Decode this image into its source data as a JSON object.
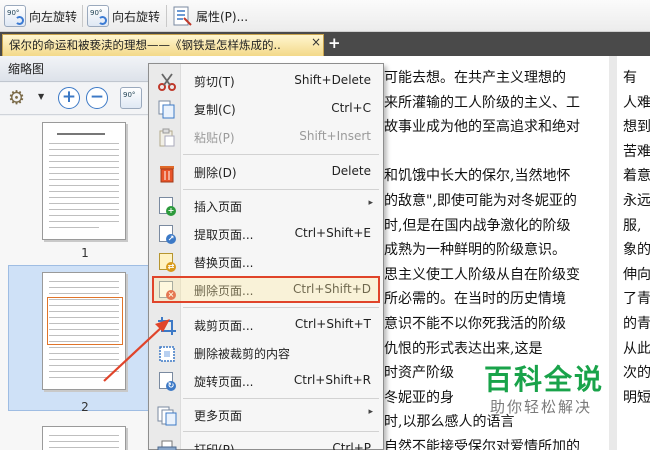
{
  "toolbar": {
    "rotate_left_icon_text": "90°",
    "rotate_left_label": "向左旋转",
    "rotate_right_icon_text": "90°",
    "rotate_right_label": "向右旋转",
    "properties_label": "属性(P)..."
  },
  "tabbar": {
    "active_tab_title": "保尔的命运和被亵渎的理想——《钢铁是怎样炼成的..",
    "close_glyph": "×",
    "add_glyph": "+"
  },
  "thumbnail_panel": {
    "title": "缩略图",
    "zoom_in_glyph": "+",
    "zoom_out_glyph": "−",
    "rotate_icon_text": "90°",
    "pages": [
      {
        "number": "1"
      },
      {
        "number": "2",
        "selected": true
      }
    ]
  },
  "document": {
    "left_column": [
      "可能去想。在共产主义理想的",
      "来所灌输的工人阶级的主义、工",
      "故事业成为他的至高追求和绝对",
      "",
      "和饥饿中长大的保尔,当然地怀",
      "的敌意\",即使可能为对冬妮亚的",
      "时,但是在国内战争激化的阶级",
      "成熟为一种鲜明的阶级意识。",
      "思主义使工人阶级从自在阶级变",
      "所必需的。在当时的历史情境",
      "意识不能不以你死我活的阶级",
      "仇恨的形式表达出来,这是",
      "时资产阶级",
      "冬妮亚的身",
      "时,以那么感人的语言",
      "自然不能接受保尔对爱情所加的"
    ],
    "right_column": [
      "有",
      "人难",
      "想到",
      "苦难",
      "着意",
      "永远",
      "服,",
      "象的",
      "伸向",
      "了青",
      "的青",
      "从此",
      "次的",
      "明短"
    ]
  },
  "context_menu": {
    "items": [
      {
        "label": "剪切(T)",
        "shortcut": "Shift+Delete",
        "icon": "scissors-icon",
        "disabled": false
      },
      {
        "label": "复制(C)",
        "shortcut": "Ctrl+C",
        "icon": "copy-icon",
        "disabled": false
      },
      {
        "label": "粘贴(P)",
        "shortcut": "Shift+Insert",
        "icon": "paste-icon",
        "disabled": true
      },
      {
        "label": "删除(D)",
        "shortcut": "Delete",
        "icon": "trash-icon",
        "disabled": false
      },
      {
        "label": "插入页面",
        "shortcut": "",
        "submenu": "▸",
        "icon": "insert-page-icon",
        "disabled": false
      },
      {
        "label": "提取页面...",
        "shortcut": "Ctrl+Shift+E",
        "icon": "extract-page-icon",
        "disabled": false
      },
      {
        "label": "替换页面...",
        "shortcut": "",
        "icon": "replace-page-icon",
        "disabled": false
      },
      {
        "label": "删除页面...",
        "shortcut": "Ctrl+Shift+D",
        "icon": "delete-page-icon",
        "disabled": false,
        "highlighted": true
      },
      {
        "label": "裁剪页面...",
        "shortcut": "Ctrl+Shift+T",
        "icon": "crop-page-icon",
        "disabled": false
      },
      {
        "label": "删除被裁剪的内容",
        "shortcut": "",
        "icon": "remove-cropped-icon",
        "disabled": false
      },
      {
        "label": "旋转页面...",
        "shortcut": "Ctrl+Shift+R",
        "icon": "rotate-page-icon",
        "disabled": false
      },
      {
        "label": "更多页面",
        "shortcut": "",
        "submenu": "▸",
        "icon": "more-pages-icon",
        "disabled": false
      },
      {
        "label": "打印(P)...",
        "shortcut": "Ctrl+P",
        "icon": "print-icon",
        "disabled": false
      }
    ]
  },
  "watermark": {
    "title": "百科全说",
    "subtitle": "助你轻松解决"
  },
  "colors": {
    "highlight_border": "#e0442a",
    "watermark_green": "#19a34a",
    "tab_gold": "#f3d98a"
  }
}
